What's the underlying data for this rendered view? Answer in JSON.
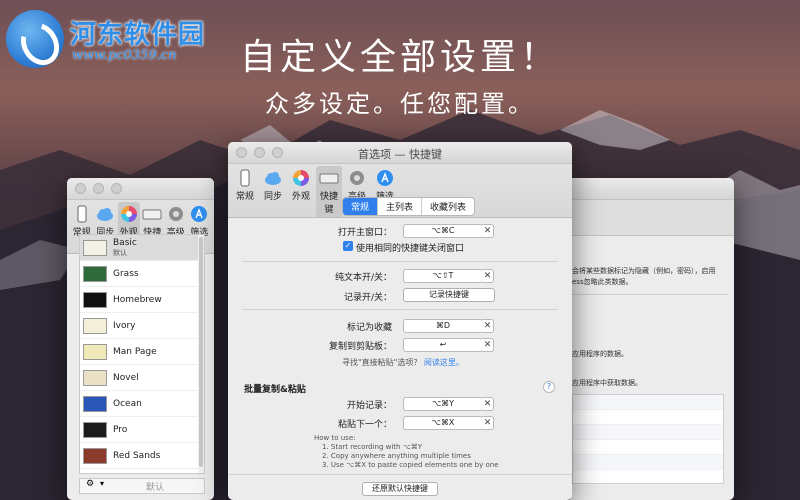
{
  "watermark": {
    "name": "河东软件园",
    "url": "www.pc0359.cn"
  },
  "hero": {
    "line1": "自定义全部设置！",
    "line2": "众多设定。任您配置。"
  },
  "left_window": {
    "toolbar": [
      "常规",
      "同步",
      "外观",
      "快捷键",
      "高级",
      "筛选"
    ],
    "active_tab": "外观",
    "themes": [
      {
        "name": "Basic",
        "sub": "默认",
        "color": "#f4f1e6"
      },
      {
        "name": "Grass",
        "color": "#2f6b3a"
      },
      {
        "name": "Homebrew",
        "color": "#111111"
      },
      {
        "name": "Ivory",
        "color": "#f3efd9"
      },
      {
        "name": "Man Page",
        "color": "#f0e9b8"
      },
      {
        "name": "Novel",
        "color": "#eae0c5"
      },
      {
        "name": "Ocean",
        "color": "#2a56b8"
      },
      {
        "name": "Pro",
        "color": "#1c1c1c"
      },
      {
        "name": "Red Sands",
        "color": "#8c3a2c"
      }
    ],
    "bottom": {
      "gear": "⚙",
      "chevron": "▾",
      "default_label": "默认"
    }
  },
  "front_window": {
    "title": "首选项 — 快捷键",
    "toolbar": [
      "常规",
      "同步",
      "外观",
      "快捷键",
      "高级",
      "筛选"
    ],
    "active_tab": "快捷键",
    "segments": [
      "常规",
      "主列表",
      "收藏列表"
    ],
    "active_segment": "常规",
    "open_main": {
      "label": "打开主窗口：",
      "key": "⌥⌘C"
    },
    "same_shortcut_close": "使用相同的快捷键关闭窗口",
    "plain_text": {
      "label": "纯文本开/关：",
      "key": "⌥⇧T"
    },
    "record_toggle": {
      "label": "记录开/关：",
      "button": "记录快捷键"
    },
    "mark_favorite": {
      "label": "标记为收藏",
      "key": "⌘D"
    },
    "copy_clipboard": {
      "label": "复制到剪贴板：",
      "key": "↩"
    },
    "find_paste_hint": "寻找\"直接粘贴\"选项？",
    "read_here": "阅读这里。",
    "batch_section": "批量复制&粘贴",
    "help": "?",
    "start_record": {
      "label": "开始记录：",
      "key": "⌥⌘Y"
    },
    "paste_next": {
      "label": "粘贴下一个：",
      "key": "⌥⌘X"
    },
    "howto": {
      "title": "How to use:",
      "step1": "1. Start recording with ⌥⌘Y",
      "step2": "2. Copy anywhere anything multiple times",
      "step3": "3. Use ⌥⌘X to paste copied elements one by one"
    },
    "restore_button": "还原默认快捷键"
  },
  "right_window": {
    "text1": "会将某些数据标记为隐藏（例如，密码），启用",
    "text2": "ess忽略此类数据。",
    "text3": "应用程序的数据。",
    "text4": "应用程序中获取数据。"
  },
  "colors": {
    "accent": "#2f80ec"
  }
}
